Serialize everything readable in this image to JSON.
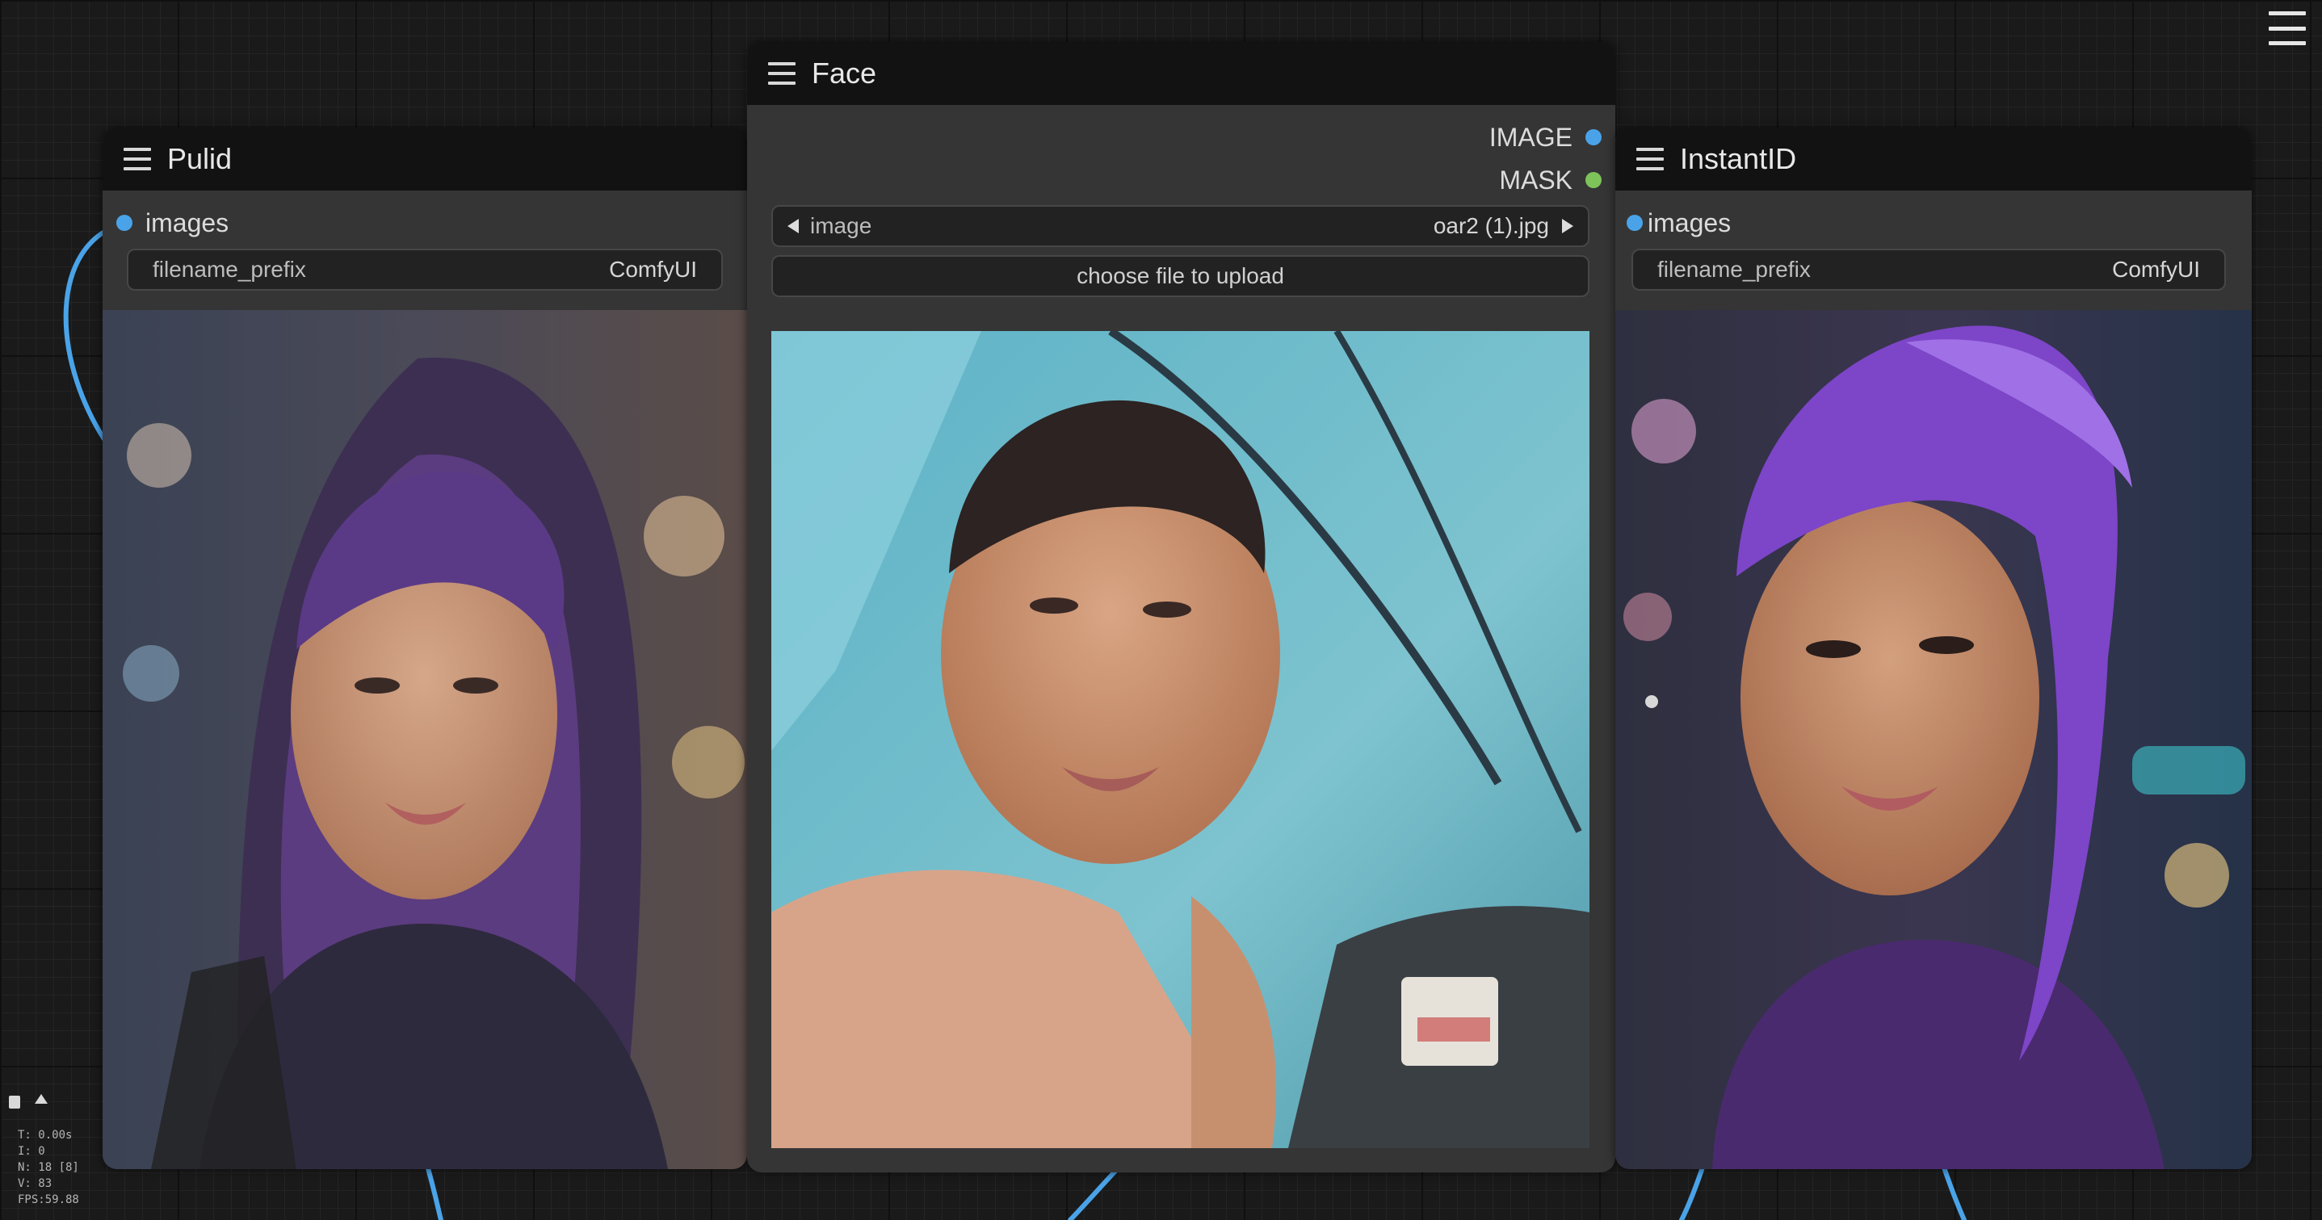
{
  "nodes": {
    "pulid": {
      "title": "Pulid",
      "input_label": "images",
      "filename_prefix": {
        "name": "filename_prefix",
        "value": "ComfyUI"
      }
    },
    "face": {
      "title": "Face",
      "output_image": "IMAGE",
      "output_mask": "MASK",
      "image_widget": {
        "name": "image",
        "value": "oar2 (1).jpg"
      },
      "upload_button": "choose file to upload"
    },
    "instantid": {
      "title": "InstantID",
      "input_label": "images",
      "filename_prefix": {
        "name": "filename_prefix",
        "value": "ComfyUI"
      }
    }
  },
  "stats": {
    "time": "T: 0.00s",
    "iterations": "I: 0",
    "nodes": "N: 18 [8]",
    "vertices": "V: 83",
    "fps": "FPS:59.88"
  },
  "colors": {
    "image_slot": "#4aa3e8",
    "mask_slot": "#7ec35a",
    "wire": "#4aa3e8",
    "node_body": "#353535",
    "node_title": "#121212"
  },
  "icons": [
    "menu-icon",
    "arrow-left-icon",
    "arrow-right-icon",
    "save-icon",
    "pin-icon"
  ]
}
